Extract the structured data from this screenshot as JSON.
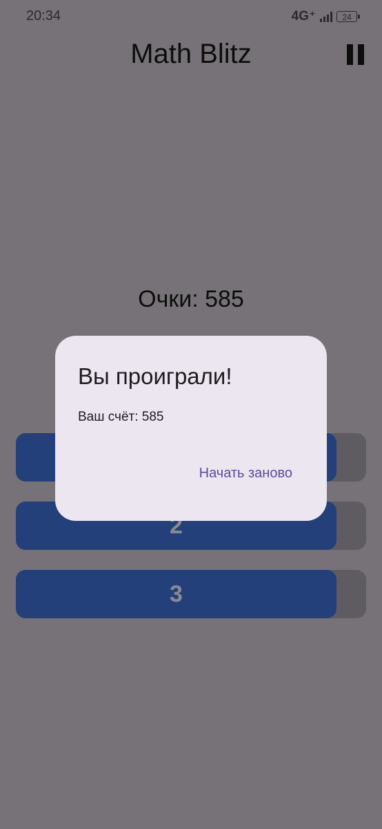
{
  "status_bar": {
    "time": "20:34",
    "network": "4G⁺",
    "battery": "24"
  },
  "app": {
    "title": "Math Blitz",
    "pause_icon": "pause-icon"
  },
  "game": {
    "score_text": "Очки: 585",
    "answers": [
      {
        "label": ""
      },
      {
        "label": "2"
      },
      {
        "label": "3"
      }
    ]
  },
  "dialog": {
    "title": "Вы проиграли!",
    "body": "Ваш счёт: 585",
    "action_label": "Начать заново"
  },
  "colors": {
    "scrim_background": "#777277",
    "answer_button": "#23407a",
    "dialog_background": "#ece6f0",
    "dialog_action": "#5a4d99"
  }
}
